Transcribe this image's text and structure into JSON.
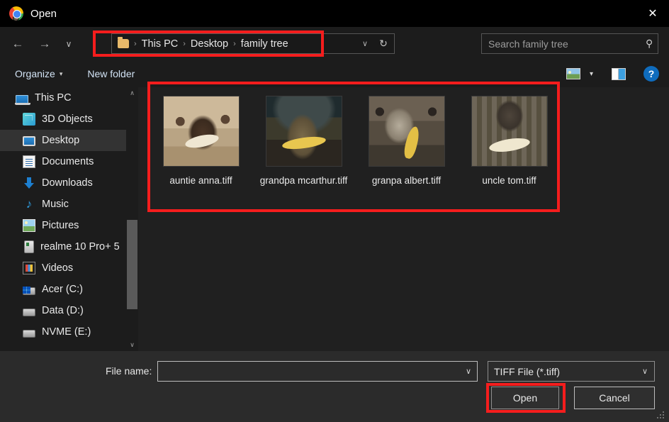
{
  "window": {
    "title": "Open",
    "app_icon": "chrome-icon",
    "close_label": "✕"
  },
  "nav": {
    "back_icon": "←",
    "forward_icon": "→",
    "recent_icon": "∨",
    "up_icon": "↑",
    "breadcrumb": {
      "folder_icon": "folder-icon",
      "separator": "›",
      "items": [
        "This PC",
        "Desktop",
        "family tree"
      ],
      "dropdown_icon": "∨",
      "refresh_icon": "↻"
    },
    "search": {
      "placeholder": "Search family tree",
      "icon": "⚲"
    }
  },
  "commandbar": {
    "organize_label": "Organize",
    "organize_caret": "▾",
    "new_folder_label": "New folder",
    "view_icon": "view-mode-icon",
    "view_caret": "▾",
    "preview_pane_icon": "preview-pane-icon",
    "help_label": "?"
  },
  "sidebar": {
    "items": [
      {
        "label": "This PC",
        "icon": "this-pc-icon",
        "selected": false,
        "root": true
      },
      {
        "label": "3D Objects",
        "icon": "3d-objects-icon",
        "selected": false,
        "root": false
      },
      {
        "label": "Desktop",
        "icon": "desktop-icon",
        "selected": true,
        "root": false
      },
      {
        "label": "Documents",
        "icon": "documents-icon",
        "selected": false,
        "root": false
      },
      {
        "label": "Downloads",
        "icon": "downloads-icon",
        "selected": false,
        "root": false
      },
      {
        "label": "Music",
        "icon": "music-icon",
        "selected": false,
        "root": false
      },
      {
        "label": "Pictures",
        "icon": "pictures-icon",
        "selected": false,
        "root": false
      },
      {
        "label": "realme 10 Pro+ 5",
        "icon": "phone-icon",
        "selected": false,
        "root": false
      },
      {
        "label": "Videos",
        "icon": "videos-icon",
        "selected": false,
        "root": false
      },
      {
        "label": "Acer (C:)",
        "icon": "drive-icon",
        "selected": false,
        "root": false
      },
      {
        "label": "Data (D:)",
        "icon": "drive-icon",
        "selected": false,
        "root": false
      },
      {
        "label": "NVME (E:)",
        "icon": "drive-icon",
        "selected": false,
        "root": false
      }
    ],
    "scroll_up_icon": "∧",
    "scroll_down_icon": "∨"
  },
  "files": [
    {
      "name": "auntie anna.tiff",
      "thumb": "th1"
    },
    {
      "name": "grandpa mcarthur.tiff",
      "thumb": "th2"
    },
    {
      "name": "granpa albert.tiff",
      "thumb": "th3"
    },
    {
      "name": "uncle tom.tiff",
      "thumb": "th4"
    }
  ],
  "footer": {
    "file_name_label": "File name:",
    "file_name_value": "",
    "file_name_caret": "∨",
    "file_type_value": "TIFF File (*.tiff)",
    "file_type_caret": "∨",
    "open_label": "Open",
    "cancel_label": "Cancel"
  },
  "highlights": {
    "color": "#f51d1d",
    "targets": [
      "breadcrumb-bar",
      "file-tiles-area",
      "open-button"
    ]
  }
}
